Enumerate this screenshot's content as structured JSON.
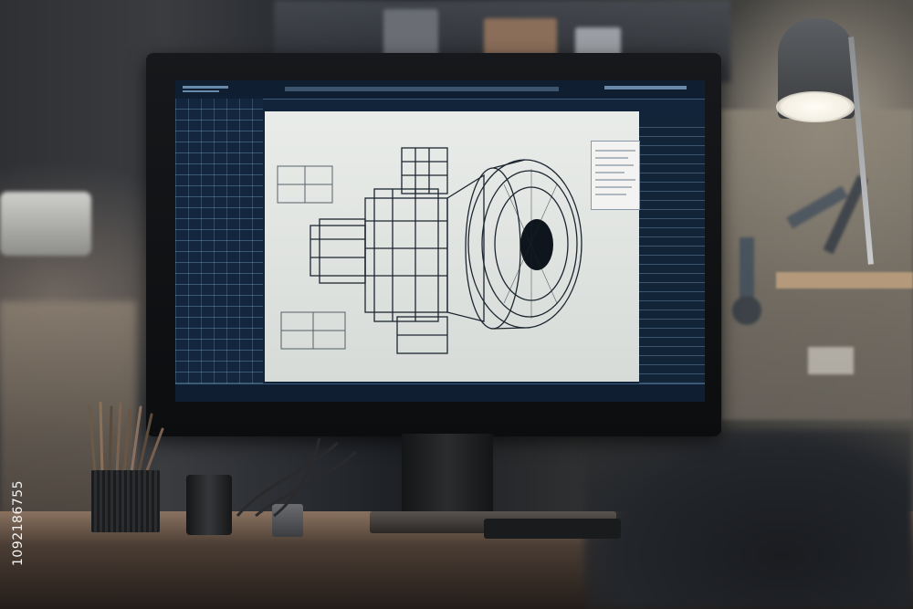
{
  "scene": {
    "watermark_id": "1092186755",
    "colors": {
      "screen_bg": "#12243a",
      "canvas_bg": "#e3e6e3",
      "ui_lines": "#8cb4d7",
      "drawing_lines": "#2a3440"
    },
    "icons": [
      "desk-lamp-icon",
      "pencil-cup-icon",
      "jet-engine-wireframe"
    ]
  }
}
